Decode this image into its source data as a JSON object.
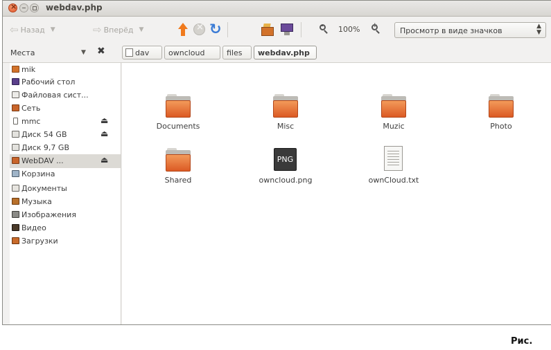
{
  "window": {
    "title": "webdav.php"
  },
  "toolbar": {
    "back_label": "Назад",
    "forward_label": "Вперёд",
    "zoom_level": "100%",
    "view_mode": "Просмотр в виде значков"
  },
  "location": {
    "places_label": "Места",
    "breadcrumbs": [
      "dav",
      "owncloud",
      "files",
      "webdav.php"
    ]
  },
  "sidebar": {
    "items": [
      {
        "label": "mik",
        "icon": "home-folder-icon",
        "eject": false
      },
      {
        "label": "Рабочий стол",
        "icon": "desktop-icon",
        "eject": false
      },
      {
        "label": "Файловая сист...",
        "icon": "filesystem-icon",
        "eject": false
      },
      {
        "label": "Сеть",
        "icon": "network-icon",
        "eject": false
      },
      {
        "label": "mmc",
        "icon": "sd-card-icon",
        "eject": true
      },
      {
        "label": "Диск 54 GB",
        "icon": "drive-icon",
        "eject": true
      },
      {
        "label": "Диск 9,7 GB",
        "icon": "drive-icon",
        "eject": false
      },
      {
        "label": "WebDAV ...",
        "icon": "network-drive-icon",
        "eject": true
      },
      {
        "label": "Корзина",
        "icon": "trash-icon",
        "eject": false
      },
      {
        "label": "Документы",
        "icon": "documents-folder-icon",
        "eject": false
      },
      {
        "label": "Музыка",
        "icon": "music-folder-icon",
        "eject": false
      },
      {
        "label": "Изображения",
        "icon": "pictures-folder-icon",
        "eject": false
      },
      {
        "label": "Видео",
        "icon": "videos-folder-icon",
        "eject": false
      },
      {
        "label": "Загрузки",
        "icon": "downloads-folder-icon",
        "eject": false
      }
    ]
  },
  "files": [
    {
      "name": "Documents",
      "type": "folder"
    },
    {
      "name": "Misc",
      "type": "folder"
    },
    {
      "name": "Muzic",
      "type": "folder"
    },
    {
      "name": "Photo",
      "type": "folder"
    },
    {
      "name": "Shared",
      "type": "folder"
    },
    {
      "name": "owncloud.png",
      "type": "image",
      "badge": "PNG"
    },
    {
      "name": "ownCloud.txt",
      "type": "text"
    }
  ],
  "caption": "Рис.",
  "colors": {
    "accent": "#dc5a24",
    "selection": "#dcdad5",
    "reload": "#3a7bd5",
    "up": "#f07a1d"
  }
}
